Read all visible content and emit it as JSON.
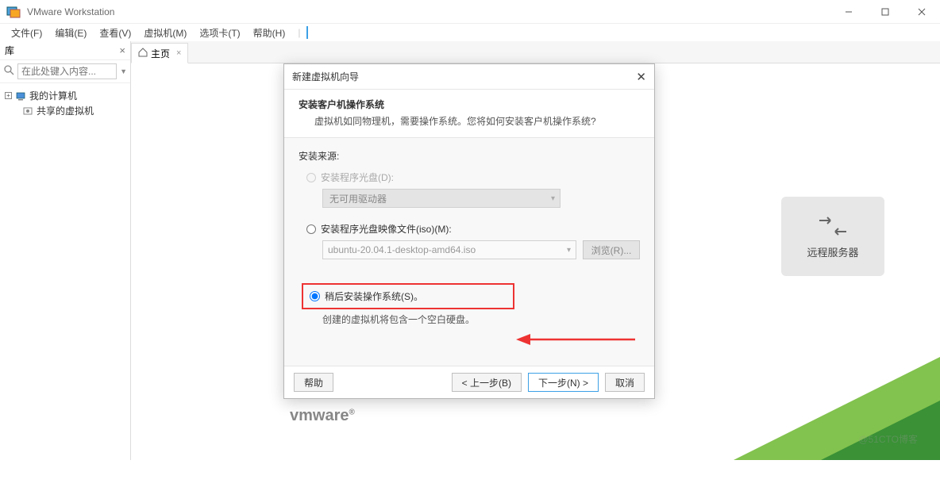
{
  "titlebar": {
    "title": "VMware Workstation"
  },
  "menubar": {
    "file": "文件(F)",
    "edit": "编辑(E)",
    "view": "查看(V)",
    "vm": "虚拟机(M)",
    "tabs": "选项卡(T)",
    "help": "帮助(H)"
  },
  "sidebar": {
    "title": "库",
    "search_placeholder": "在此处键入内容...",
    "tree": {
      "root": "我的计算机",
      "child": "共享的虚拟机"
    }
  },
  "tabs": {
    "home": "主页"
  },
  "card": {
    "label": "远程服务器"
  },
  "logo": {
    "text": "vmware"
  },
  "dialog": {
    "title": "新建虚拟机向导",
    "head_title": "安装客户机操作系统",
    "head_sub": "虚拟机如同物理机，需要操作系统。您将如何安装客户机操作系统?",
    "source_label": "安装来源:",
    "opt_disc": "安装程序光盘(D):",
    "disc_none": "无可用驱动器",
    "opt_iso": "安装程序光盘映像文件(iso)(M):",
    "iso_value": "ubuntu-20.04.1-desktop-amd64.iso",
    "browse": "浏览(R)...",
    "opt_later": "稍后安装操作系统(S)。",
    "later_note": "创建的虚拟机将包含一个空白硬盘。",
    "btn_help": "帮助",
    "btn_back": "< 上一步(B)",
    "btn_next": "下一步(N) >",
    "btn_cancel": "取消"
  },
  "watermark": "@51CTO博客"
}
